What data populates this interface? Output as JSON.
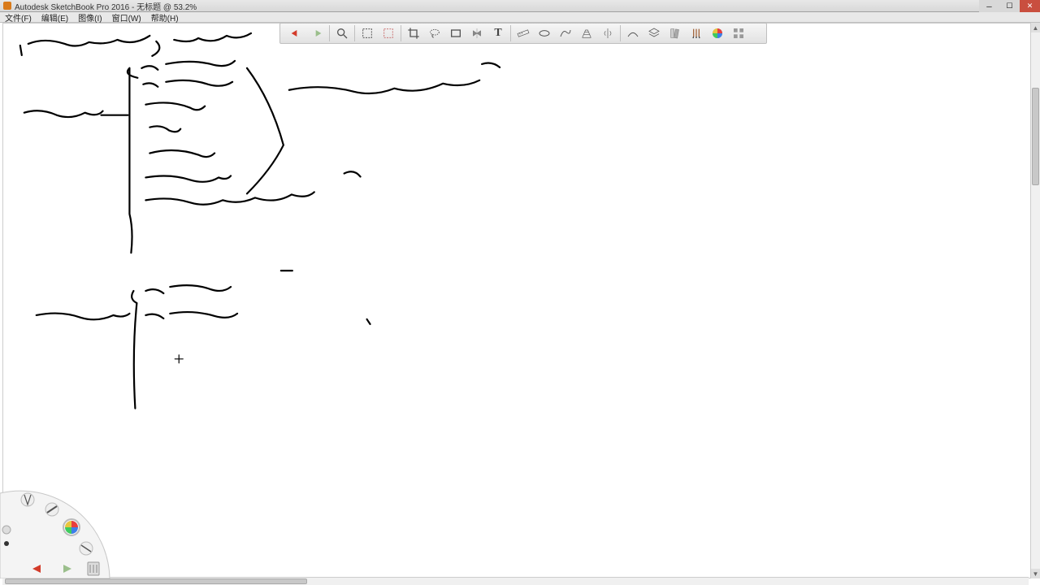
{
  "titlebar": {
    "app_name": "Autodesk SketchBook Pro 2016",
    "doc_name": "无标题",
    "zoom": "53.2%",
    "separator": " - ",
    "at": " @ "
  },
  "menubar": {
    "file": "文件(F)",
    "edit": "编辑(E)",
    "image": "图像(I)",
    "window": "窗口(W)",
    "help": "帮助(H)"
  },
  "toolbar": {
    "undo": "undo-icon",
    "redo": "redo-icon",
    "zoom": "zoom-icon",
    "marquee": "marquee-icon",
    "marquee_invert": "marquee-invert-icon",
    "crop": "crop-icon",
    "lasso": "lasso-icon",
    "rect": "rect-icon",
    "flip": "flip-icon",
    "text": "T",
    "ruler": "ruler-icon",
    "ellipse_ruler": "ellipse-ruler-icon",
    "french": "french-curve-icon",
    "perspective": "perspective-icon",
    "symmetry": "symmetry-icon",
    "steady": "steady-stroke-icon",
    "layer": "layer-icon",
    "swatches": "swatches-icon",
    "brushset": "brushset-icon",
    "color": "color-wheel-icon",
    "library": "library-icon"
  },
  "colors": {
    "undo_arrow": "#d33b2a",
    "redo_arrow": "#6aa44a",
    "icon_gray": "#6b6b6b",
    "close_btn": "#c94f3f"
  },
  "canvas_notes": {
    "lines": [
      "1. 设备树 你能过什么? 有什么优点",
      "I²c  board info",
      "spi  board info",
      "资源信息",
      "GPIO",
      "时钟 信息",
      "platform 数据",
      "platform 设备 (包含. 设备信息)",
      "kernel/arch/arm/mach-xxx 目录下",
      "以前 内核",
      "现在的方式",
      "I²c  板级信息",
      "spi  板级信息"
    ]
  }
}
